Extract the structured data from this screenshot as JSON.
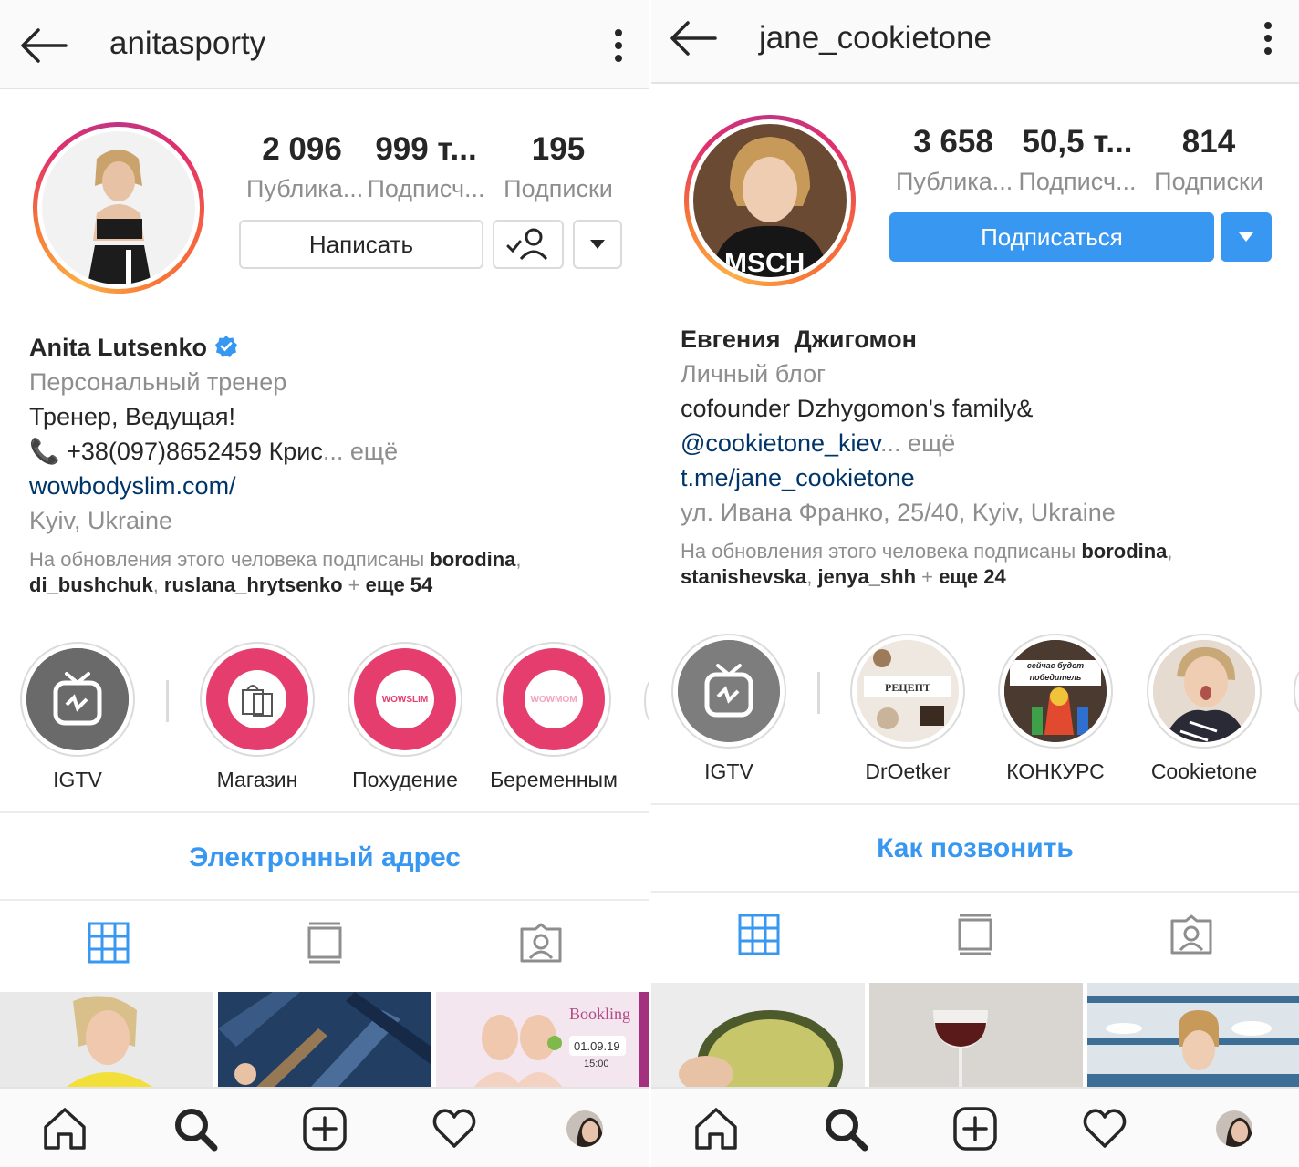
{
  "colors": {
    "accent": "#3897f0",
    "link": "#003569",
    "muted": "#8e8e8e",
    "text": "#262626",
    "highlight_pink": "#e63d6f"
  },
  "left": {
    "header": {
      "username": "anitasporty"
    },
    "stats": [
      {
        "value": "2 096",
        "label": "Публика..."
      },
      {
        "value": "999 т...",
        "label": "Подписч..."
      },
      {
        "value": "195",
        "label": "Подписки"
      }
    ],
    "buttons": {
      "message": "Написать"
    },
    "bio": {
      "name": "Anita Lutsenko",
      "category": "Персональный тренер",
      "line1": "Тренер, Ведущая!",
      "phone": "📞 +38(097)8652459 Крис",
      "more": "... ещё",
      "website": "wowbodyslim.com/",
      "location": "Kyiv, Ukraine",
      "followed_by_prefix": "На обновления этого человека подписаны ",
      "followed_by_1": "borodina",
      "followed_by_2": "di_bushchuk",
      "followed_by_3": "ruslana_hrytsenko",
      "followed_by_more": "еще 54"
    },
    "highlights": [
      {
        "label": "IGTV"
      },
      {
        "label": "Магазин"
      },
      {
        "label": "Похудение",
        "badge": "WOWSLIM"
      },
      {
        "label": "Беременным",
        "badge": "WOWMOM"
      }
    ],
    "contact": "Электронный адрес",
    "post3": {
      "brand": "Bookling",
      "date": "01.09.19",
      "time": "15:00"
    }
  },
  "right": {
    "header": {
      "username": "jane_cookietone"
    },
    "stats": [
      {
        "value": "3 658",
        "label": "Публика..."
      },
      {
        "value": "50,5 т...",
        "label": "Подписч..."
      },
      {
        "value": "814",
        "label": "Подписки"
      }
    ],
    "buttons": {
      "follow": "Подписаться"
    },
    "bio": {
      "name": "Евгения  Джигомон",
      "category": "Личный блог",
      "line1": "cofounder Dzhygomon's family&",
      "mention": "@cookietone_kiev",
      "more": "... ещё",
      "website": "t.me/jane_cookietone",
      "location": "ул. Ивана Франко, 25/40, Kyiv, Ukraine",
      "followed_by_prefix": "На обновления этого человека подписаны ",
      "followed_by_1": "borodina",
      "followed_by_2": "stanishevska",
      "followed_by_3": "jenya_shh",
      "followed_by_more": "еще 24"
    },
    "highlights": [
      {
        "label": "IGTV"
      },
      {
        "label": "DrOetker",
        "badge": "РЕЦЕПТ"
      },
      {
        "label": "КОНКУРС",
        "badge": "сейчас будет победитель"
      },
      {
        "label": "Cookietone"
      }
    ],
    "contact": "Как позвонить"
  }
}
